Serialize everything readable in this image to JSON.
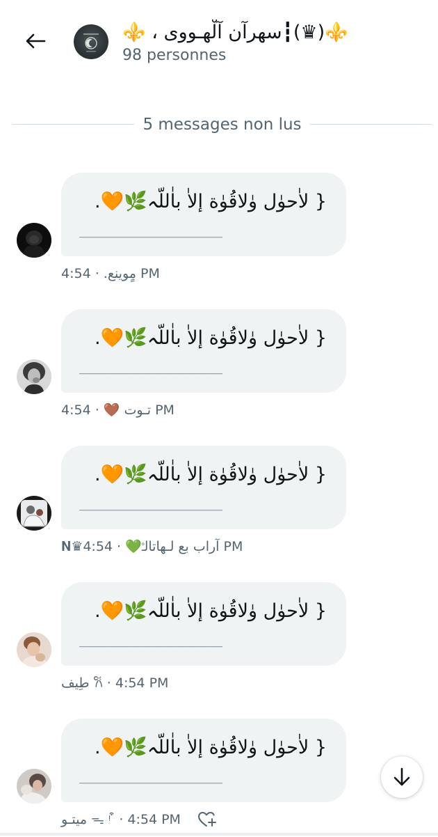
{
  "header": {
    "title": "⚜️(♛)┇سهرآن آلْهـووى ، ⚜️",
    "subtitle": "98 personnes"
  },
  "divider": {
    "text": "5 messages non lus"
  },
  "messages": [
    {
      "line1": "{ لاٰحوٰل وٰلاقُوٰة إلاٰ باٰللّہ🌿🧡.",
      "line2": "___________________",
      "meta": "مٍوينع. · 4:54 PM"
    },
    {
      "line1": "{ لاٰحوٰل وٰلاقُوٰة إلاٰ باٰللّہ🌿🧡.",
      "line2": "___________________",
      "meta": "تـوت 🤎 · 4:54 PM"
    },
    {
      "line1": "{ لاٰحوٰل وٰلاقُوٰة إلاٰ باٰللّہ🌿🧡.",
      "line2": "___________________",
      "meta": "𝐍♛آراب بع لـهاتالـ۫💚 · 4:54 PM"
    },
    {
      "line1": "{ لاٰحوٰل وٰلاقُوٰة إلاٰ باٰللّہ🌿🧡.",
      "line2": "___________________",
      "meta": "طِيف 𐙚 · 4:54 PM"
    },
    {
      "line1": "{ لاٰحوٰل وٰلاقُوٰة إلاٰ باٰللّہ🌿🧡.",
      "line2": "___________________",
      "meta": "ميتـو ᯓ ᵎ ͒ · 4:54 PM"
    }
  ],
  "colors": {
    "bubble": "#eff3f4",
    "meta_text": "#536471",
    "primary_text": "#0f1419",
    "divider_line": "#cfd9de"
  },
  "icons": {
    "back": "arrow-left-icon",
    "scroll": "arrow-down-icon",
    "react": "heart-plus-icon"
  }
}
